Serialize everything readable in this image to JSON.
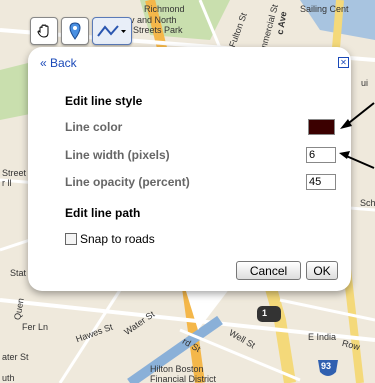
{
  "map": {
    "labels": {
      "richmond": "Richmond",
      "ov_north": "ov  and North",
      "streets_park": "um  Streets Park",
      "sailing": "Sailing Cent",
      "ave": "c Ave",
      "fulton": "Fulton St",
      "commercial": "Commercial St",
      "street_ll": "Street",
      "street_ll2": "r ll",
      "stat": "Stat",
      "queen": "Quen",
      "fer_ln": "Fer Ln",
      "hawes": "Hawes St",
      "water_st": "Water St",
      "water_st2": "ater St",
      "rd_st": "rd St",
      "well_st": "Well St",
      "e_india": "E India",
      "row": "Row",
      "hilton": "Hilton Boston",
      "financial": "Financial District",
      "uth": "uth",
      "route_93": "93",
      "route_1": "1",
      "sch": "Sch",
      "ui": "ui"
    }
  },
  "toolbar": {
    "hand_icon": "hand-icon",
    "marker_icon": "marker-icon",
    "line_icon": "line-icon"
  },
  "panel": {
    "back_label": "« Back",
    "close_label": "✕",
    "edit_style_title": "Edit line style",
    "line_color_label": "Line color",
    "line_color_value": "#3b0000",
    "line_width_label": "Line width (pixels)",
    "line_width_value": "6",
    "line_opacity_label": "Line opacity (percent)",
    "line_opacity_value": "45",
    "edit_path_title": "Edit line path",
    "snap_label": "Snap to roads",
    "snap_checked": false,
    "cancel_label": "Cancel",
    "ok_label": "OK"
  },
  "colors": {
    "link": "#1a49b8",
    "map_bg": "#efe9dc",
    "road_yellow": "#f4d97a",
    "water": "#a8c4e0",
    "park": "#c9dfae"
  }
}
